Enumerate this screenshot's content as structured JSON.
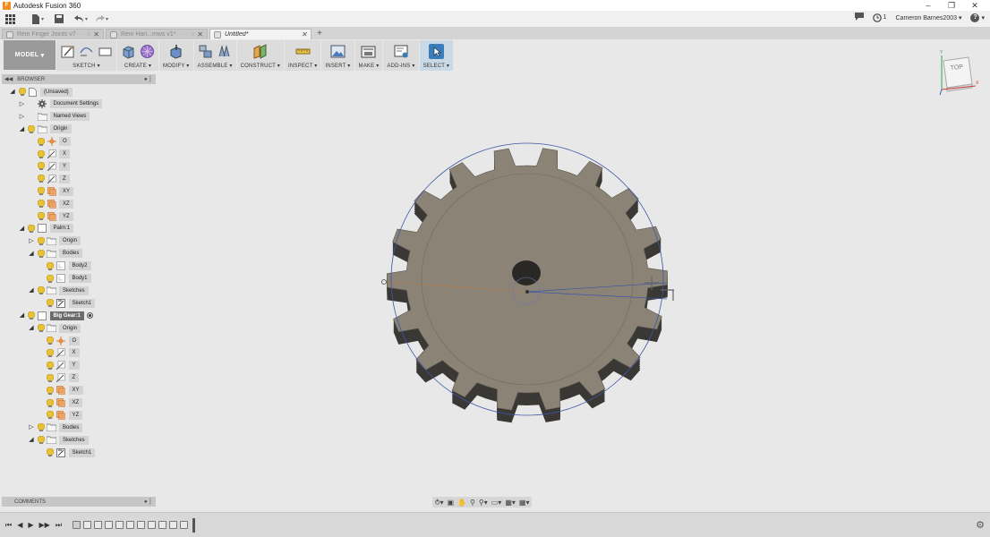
{
  "titlebar": {
    "title": "Autodesk Fusion 360",
    "minimize": "–",
    "maximize": "❐",
    "close": "✕"
  },
  "quickbar": {
    "grid_icon": "grid-icon",
    "file_icon": "file-icon",
    "save_icon": "save-icon",
    "undo_icon": "undo-icon",
    "redo_icon": "redo-icon",
    "job_status_count": "1",
    "user": "Cameron Barnes2003",
    "help": "?"
  },
  "tabs": [
    {
      "label": "Rein Finger Joints v7",
      "active": false
    },
    {
      "label": "Rein Han...mws v1*",
      "active": false
    },
    {
      "label": "Untitled*",
      "active": true
    }
  ],
  "toolbar": {
    "workspace": "MODEL",
    "groups": [
      {
        "label": "SKETCH",
        "key": "sketch"
      },
      {
        "label": "CREATE",
        "key": "create"
      },
      {
        "label": "MODIFY",
        "key": "modify"
      },
      {
        "label": "ASSEMBLE",
        "key": "assemble"
      },
      {
        "label": "CONSTRUCT",
        "key": "construct"
      },
      {
        "label": "INSPECT",
        "key": "inspect"
      },
      {
        "label": "INSERT",
        "key": "insert"
      },
      {
        "label": "MAKE",
        "key": "make"
      },
      {
        "label": "ADD-INS",
        "key": "addins"
      },
      {
        "label": "SELECT",
        "key": "select"
      }
    ]
  },
  "browser": {
    "title": "BROWSER",
    "nodes": [
      {
        "label": "(Unsaved)",
        "depth": 0,
        "tri": "◢",
        "icon": "document"
      },
      {
        "label": "Document Settings",
        "depth": 1,
        "tri": "▷",
        "icon": "gear",
        "nobulb": true
      },
      {
        "label": "Named Views",
        "depth": 1,
        "tri": "▷",
        "icon": "folder",
        "nobulb": true
      },
      {
        "label": "Origin",
        "depth": 1,
        "tri": "◢",
        "icon": "folder"
      },
      {
        "label": "O",
        "depth": 2,
        "tri": "",
        "icon": "origin-point"
      },
      {
        "label": "X",
        "depth": 2,
        "tri": "",
        "icon": "axis"
      },
      {
        "label": "Y",
        "depth": 2,
        "tri": "",
        "icon": "axis"
      },
      {
        "label": "Z",
        "depth": 2,
        "tri": "",
        "icon": "axis"
      },
      {
        "label": "XY",
        "depth": 2,
        "tri": "",
        "icon": "plane"
      },
      {
        "label": "XZ",
        "depth": 2,
        "tri": "",
        "icon": "plane"
      },
      {
        "label": "YZ",
        "depth": 2,
        "tri": "",
        "icon": "plane"
      },
      {
        "label": "Palm:1",
        "depth": 1,
        "tri": "◢",
        "icon": "component"
      },
      {
        "label": "Origin",
        "depth": 2,
        "tri": "▷",
        "icon": "folder"
      },
      {
        "label": "Bodies",
        "depth": 2,
        "tri": "◢",
        "icon": "folder"
      },
      {
        "label": "Body2",
        "depth": 3,
        "tri": "",
        "icon": "body"
      },
      {
        "label": "Body1",
        "depth": 3,
        "tri": "",
        "icon": "body"
      },
      {
        "label": "Sketches",
        "depth": 2,
        "tri": "◢",
        "icon": "folder"
      },
      {
        "label": "Sketch1",
        "depth": 3,
        "tri": "",
        "icon": "sketch"
      },
      {
        "label": "Big Gear:1",
        "depth": 1,
        "tri": "◢",
        "icon": "component",
        "active": true
      },
      {
        "label": "Origin",
        "depth": 2,
        "tri": "◢",
        "icon": "folder"
      },
      {
        "label": "O",
        "depth": 3,
        "tri": "",
        "icon": "origin-point"
      },
      {
        "label": "X",
        "depth": 3,
        "tri": "",
        "icon": "axis"
      },
      {
        "label": "Y",
        "depth": 3,
        "tri": "",
        "icon": "axis"
      },
      {
        "label": "Z",
        "depth": 3,
        "tri": "",
        "icon": "axis"
      },
      {
        "label": "XY",
        "depth": 3,
        "tri": "",
        "icon": "plane"
      },
      {
        "label": "XZ",
        "depth": 3,
        "tri": "",
        "icon": "plane"
      },
      {
        "label": "YZ",
        "depth": 3,
        "tri": "",
        "icon": "plane"
      },
      {
        "label": "Bodies",
        "depth": 2,
        "tri": "▷",
        "icon": "folder"
      },
      {
        "label": "Sketches",
        "depth": 2,
        "tri": "◢",
        "icon": "folder"
      },
      {
        "label": "Sketch1",
        "depth": 3,
        "tri": "",
        "icon": "sketch"
      }
    ]
  },
  "comments": {
    "title": "COMMENTS"
  },
  "viewcube": {
    "face": "TOP",
    "axis_x": "X",
    "axis_y": "Y"
  },
  "colors": {
    "gear_face": "#8b8476",
    "gear_tooth_side": "#3a3835",
    "sketch_circle": "#3d56a8",
    "select_accent": "#3b7dbb",
    "model_button": "#9a9a9a"
  },
  "timeline": {
    "steps": 11
  }
}
